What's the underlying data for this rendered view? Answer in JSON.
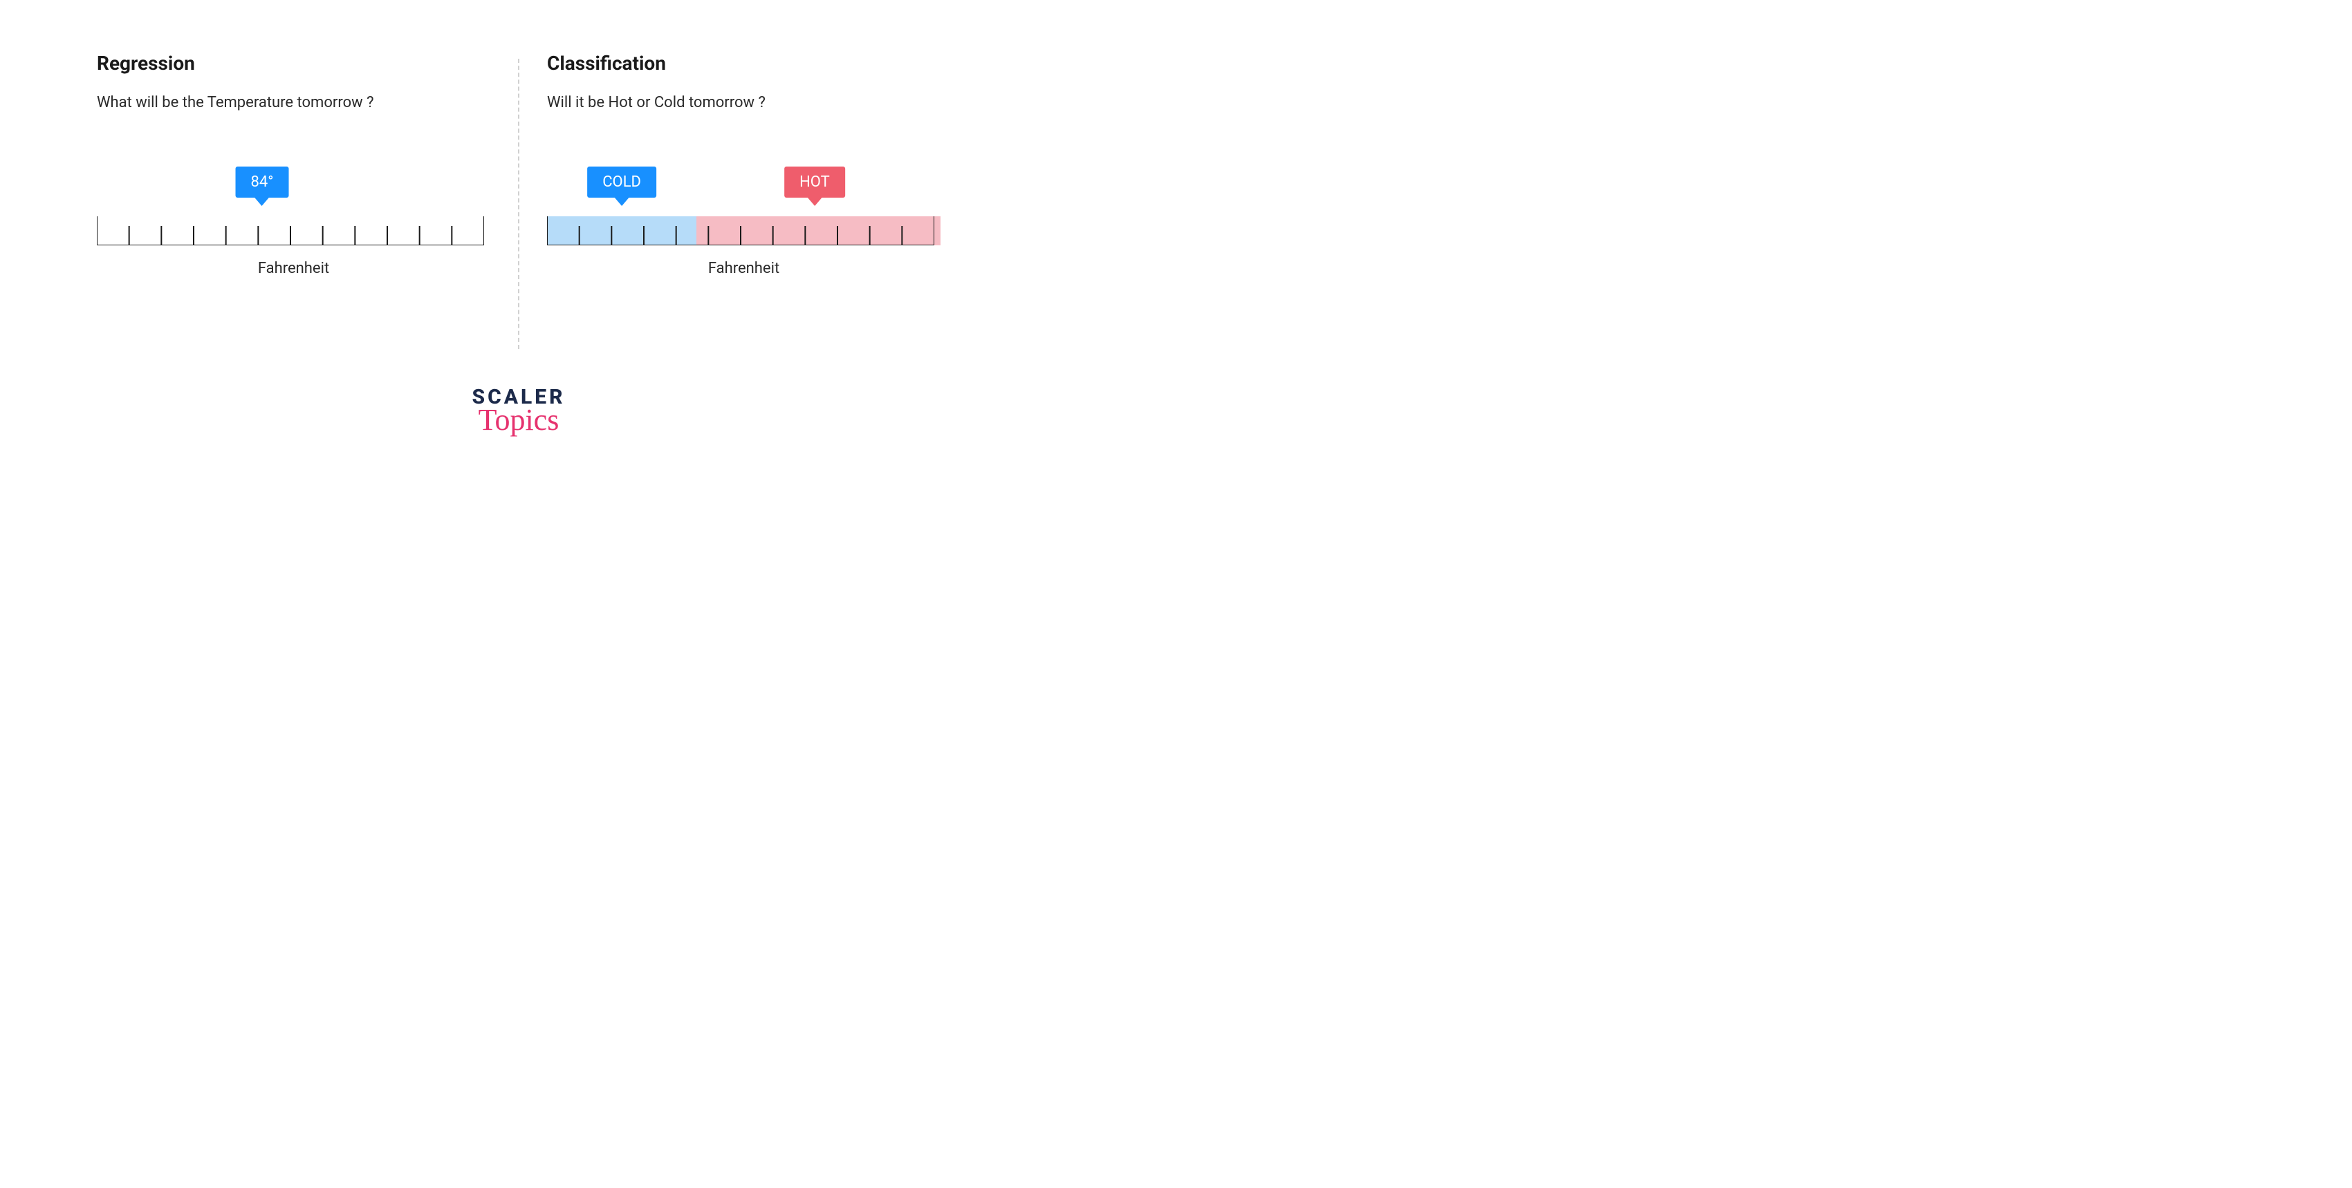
{
  "regression": {
    "title": "Regression",
    "question": "What will be the Temperature tomorrow ?",
    "value_label": "84°",
    "value_position_pct": 42,
    "axis_label": "Fahrenheit",
    "tick_count": 13
  },
  "classification": {
    "title": "Classification",
    "question": "Will it be Hot or Cold tomorrow ?",
    "cold_label": "COLD",
    "hot_label": "HOT",
    "cold_position_pct": 19,
    "hot_position_pct": 68,
    "split_pct": 38,
    "axis_label": "Fahrenheit",
    "tick_count": 13
  },
  "logo": {
    "top": "SCALER",
    "bottom": "Topics"
  },
  "colors": {
    "blue": "#1890ff",
    "red": "#ef5d6c",
    "cold_region": "#b6dcf9",
    "hot_region": "#f6bcc4",
    "logo_dark": "#1c2a4a",
    "logo_pink": "#e6326e"
  }
}
